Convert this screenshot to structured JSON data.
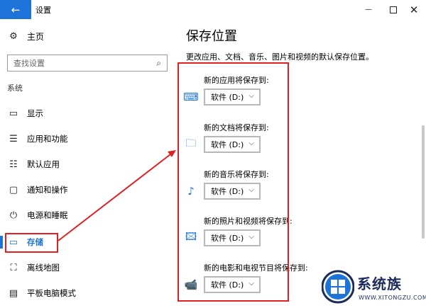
{
  "window": {
    "title": "设置",
    "back_glyph": "←",
    "minimize_glyph": "—",
    "close_glyph": "✕"
  },
  "sidebar": {
    "home_label": "主页",
    "search_placeholder": "查找设置",
    "section_label": "系统",
    "items": [
      {
        "label": "显示",
        "icon": "monitor-icon",
        "glyph": "▭"
      },
      {
        "label": "应用和功能",
        "icon": "apps-list-icon",
        "glyph": "☰"
      },
      {
        "label": "默认应用",
        "icon": "default-apps-icon",
        "glyph": "☷"
      },
      {
        "label": "通知和操作",
        "icon": "notification-icon",
        "glyph": "▢"
      },
      {
        "label": "电源和睡眠",
        "icon": "power-icon",
        "glyph": "⏻"
      },
      {
        "label": "存储",
        "icon": "storage-icon",
        "glyph": "▭",
        "active": true
      },
      {
        "label": "离线地图",
        "icon": "map-icon",
        "glyph": "⛶"
      },
      {
        "label": "平板电脑模式",
        "icon": "tablet-mode-icon",
        "glyph": "▤"
      }
    ]
  },
  "main": {
    "title": "保存位置",
    "description": "更改应用、文档、音乐、图片和视频的默认保存位置。",
    "settings": [
      {
        "label": "新的应用将保存到:",
        "value": "软件 (D:)",
        "icon": "keyboard-app-icon",
        "glyph": "⌨"
      },
      {
        "label": "新的文档将保存到:",
        "value": "软件 (D:)",
        "icon": "document-folder-icon",
        "glyph": "🗀"
      },
      {
        "label": "新的音乐将保存到:",
        "value": "软件 (D:)",
        "icon": "music-note-icon",
        "glyph": "♪"
      },
      {
        "label": "新的照片和视频将保存到:",
        "value": "软件 (D:)",
        "icon": "picture-icon",
        "glyph": "🖾"
      },
      {
        "label": "新的电影和电视节目将保存到:",
        "value": "软件 (D:)",
        "icon": "video-camera-icon",
        "glyph": "📹"
      }
    ],
    "chevron_glyph": "⌵"
  },
  "watermark": {
    "brand": "系统族",
    "domain": "WWW.XITONGZU.COM"
  },
  "colors": {
    "accent": "#1e73d8",
    "annotation_red": "#e02020"
  }
}
